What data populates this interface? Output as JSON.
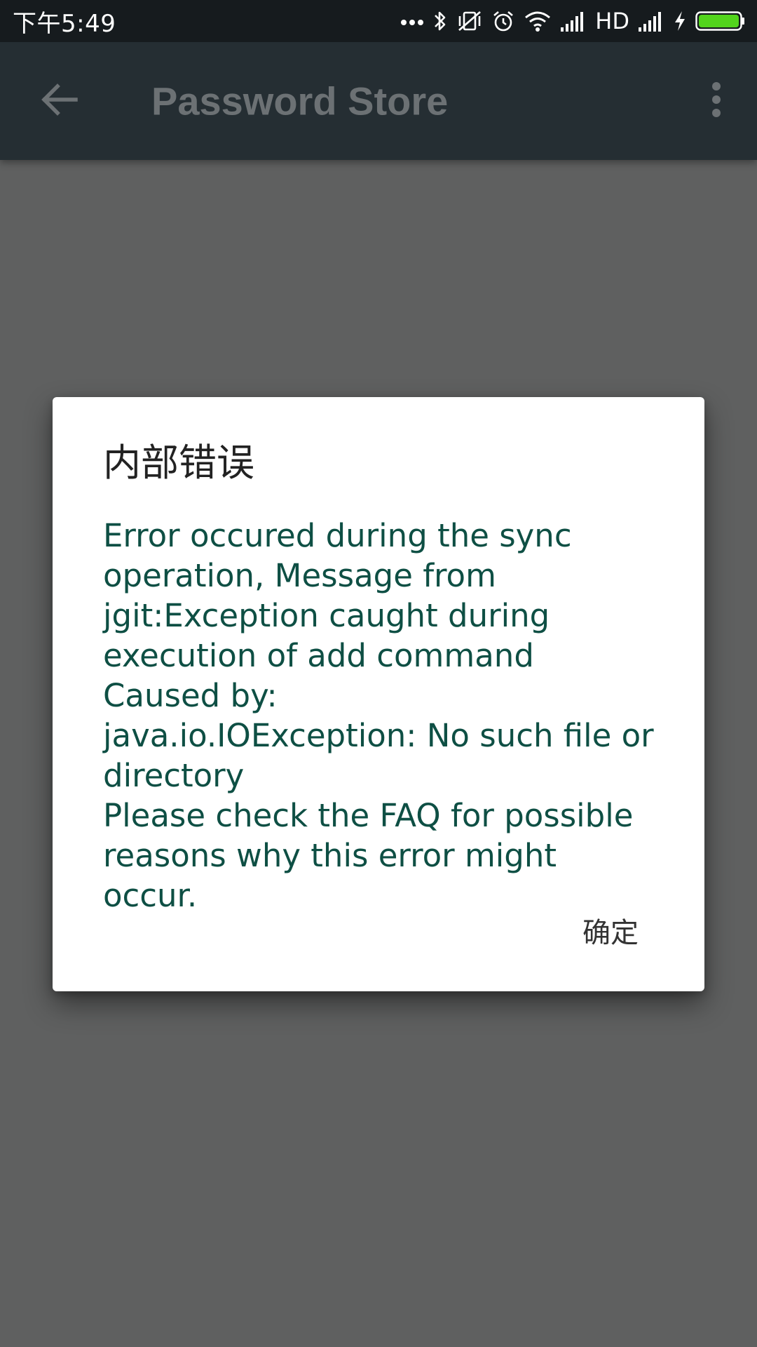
{
  "status_bar": {
    "time": "下午5:49",
    "network_label": "HD",
    "icons": [
      "more-dots-icon",
      "bluetooth-icon",
      "vibrate-off-icon",
      "alarm-icon",
      "wifi-icon",
      "signal-icon",
      "signal-icon-2",
      "charging-icon",
      "battery-icon"
    ],
    "battery_color": "#52d41c"
  },
  "toolbar": {
    "title": "Password Store",
    "icons": [
      "back-arrow-icon",
      "overflow-menu-icon"
    ]
  },
  "dialog": {
    "title": "内部错误",
    "message": "Error occured during the sync operation, Message from jgit:Exception caught during execution of add command\nCaused by:\njava.io.IOException: No such file or directory\nPlease check the FAQ for possible reasons why this error might occur.",
    "ok_label": "确定",
    "message_color": "#0e4f44"
  }
}
